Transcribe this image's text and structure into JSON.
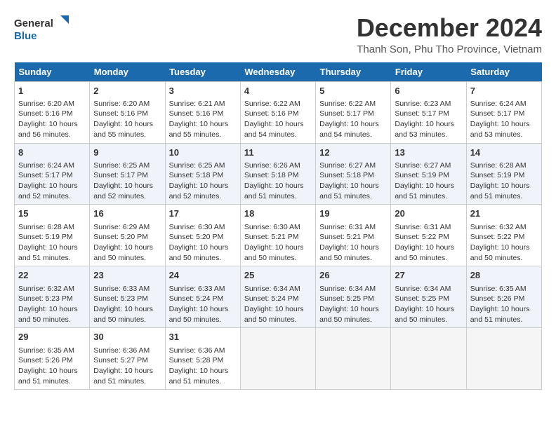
{
  "logo": {
    "line1": "General",
    "line2": "Blue"
  },
  "title": "December 2024",
  "location": "Thanh Son, Phu Tho Province, Vietnam",
  "days_of_week": [
    "Sunday",
    "Monday",
    "Tuesday",
    "Wednesday",
    "Thursday",
    "Friday",
    "Saturday"
  ],
  "weeks": [
    [
      {
        "day": 1,
        "sunrise": "6:20 AM",
        "sunset": "5:16 PM",
        "daylight": "10 hours and 56 minutes."
      },
      {
        "day": 2,
        "sunrise": "6:20 AM",
        "sunset": "5:16 PM",
        "daylight": "10 hours and 55 minutes."
      },
      {
        "day": 3,
        "sunrise": "6:21 AM",
        "sunset": "5:16 PM",
        "daylight": "10 hours and 55 minutes."
      },
      {
        "day": 4,
        "sunrise": "6:22 AM",
        "sunset": "5:16 PM",
        "daylight": "10 hours and 54 minutes."
      },
      {
        "day": 5,
        "sunrise": "6:22 AM",
        "sunset": "5:17 PM",
        "daylight": "10 hours and 54 minutes."
      },
      {
        "day": 6,
        "sunrise": "6:23 AM",
        "sunset": "5:17 PM",
        "daylight": "10 hours and 53 minutes."
      },
      {
        "day": 7,
        "sunrise": "6:24 AM",
        "sunset": "5:17 PM",
        "daylight": "10 hours and 53 minutes."
      }
    ],
    [
      {
        "day": 8,
        "sunrise": "6:24 AM",
        "sunset": "5:17 PM",
        "daylight": "10 hours and 52 minutes."
      },
      {
        "day": 9,
        "sunrise": "6:25 AM",
        "sunset": "5:17 PM",
        "daylight": "10 hours and 52 minutes."
      },
      {
        "day": 10,
        "sunrise": "6:25 AM",
        "sunset": "5:18 PM",
        "daylight": "10 hours and 52 minutes."
      },
      {
        "day": 11,
        "sunrise": "6:26 AM",
        "sunset": "5:18 PM",
        "daylight": "10 hours and 51 minutes."
      },
      {
        "day": 12,
        "sunrise": "6:27 AM",
        "sunset": "5:18 PM",
        "daylight": "10 hours and 51 minutes."
      },
      {
        "day": 13,
        "sunrise": "6:27 AM",
        "sunset": "5:19 PM",
        "daylight": "10 hours and 51 minutes."
      },
      {
        "day": 14,
        "sunrise": "6:28 AM",
        "sunset": "5:19 PM",
        "daylight": "10 hours and 51 minutes."
      }
    ],
    [
      {
        "day": 15,
        "sunrise": "6:28 AM",
        "sunset": "5:19 PM",
        "daylight": "10 hours and 51 minutes."
      },
      {
        "day": 16,
        "sunrise": "6:29 AM",
        "sunset": "5:20 PM",
        "daylight": "10 hours and 50 minutes."
      },
      {
        "day": 17,
        "sunrise": "6:30 AM",
        "sunset": "5:20 PM",
        "daylight": "10 hours and 50 minutes."
      },
      {
        "day": 18,
        "sunrise": "6:30 AM",
        "sunset": "5:21 PM",
        "daylight": "10 hours and 50 minutes."
      },
      {
        "day": 19,
        "sunrise": "6:31 AM",
        "sunset": "5:21 PM",
        "daylight": "10 hours and 50 minutes."
      },
      {
        "day": 20,
        "sunrise": "6:31 AM",
        "sunset": "5:22 PM",
        "daylight": "10 hours and 50 minutes."
      },
      {
        "day": 21,
        "sunrise": "6:32 AM",
        "sunset": "5:22 PM",
        "daylight": "10 hours and 50 minutes."
      }
    ],
    [
      {
        "day": 22,
        "sunrise": "6:32 AM",
        "sunset": "5:23 PM",
        "daylight": "10 hours and 50 minutes."
      },
      {
        "day": 23,
        "sunrise": "6:33 AM",
        "sunset": "5:23 PM",
        "daylight": "10 hours and 50 minutes."
      },
      {
        "day": 24,
        "sunrise": "6:33 AM",
        "sunset": "5:24 PM",
        "daylight": "10 hours and 50 minutes."
      },
      {
        "day": 25,
        "sunrise": "6:34 AM",
        "sunset": "5:24 PM",
        "daylight": "10 hours and 50 minutes."
      },
      {
        "day": 26,
        "sunrise": "6:34 AM",
        "sunset": "5:25 PM",
        "daylight": "10 hours and 50 minutes."
      },
      {
        "day": 27,
        "sunrise": "6:34 AM",
        "sunset": "5:25 PM",
        "daylight": "10 hours and 50 minutes."
      },
      {
        "day": 28,
        "sunrise": "6:35 AM",
        "sunset": "5:26 PM",
        "daylight": "10 hours and 51 minutes."
      }
    ],
    [
      {
        "day": 29,
        "sunrise": "6:35 AM",
        "sunset": "5:26 PM",
        "daylight": "10 hours and 51 minutes."
      },
      {
        "day": 30,
        "sunrise": "6:36 AM",
        "sunset": "5:27 PM",
        "daylight": "10 hours and 51 minutes."
      },
      {
        "day": 31,
        "sunrise": "6:36 AM",
        "sunset": "5:28 PM",
        "daylight": "10 hours and 51 minutes."
      },
      null,
      null,
      null,
      null
    ]
  ],
  "sunrise_label": "Sunrise:",
  "sunset_label": "Sunset:",
  "daylight_label": "Daylight:"
}
